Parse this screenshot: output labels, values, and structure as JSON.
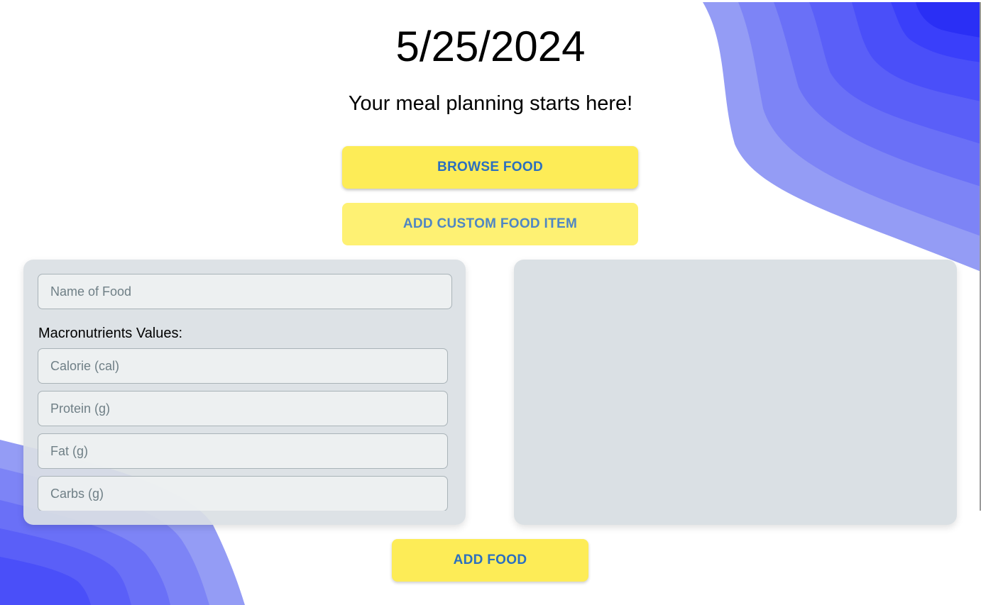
{
  "header": {
    "date": "5/25/2024",
    "subtitle": "Your meal planning starts here!"
  },
  "actions": {
    "browse_label": "BROWSE FOOD",
    "custom_label": "ADD CUSTOM FOOD ITEM",
    "add_label": "ADD FOOD"
  },
  "form": {
    "name_placeholder": "Name of Food",
    "macros_label": "Macronutrients Values:",
    "calorie_placeholder": "Calorie (cal)",
    "protein_placeholder": "Protein (g)",
    "fat_placeholder": "Fat (g)",
    "carbs_placeholder": "Carbs (g)"
  },
  "colors": {
    "button_yellow": "#fdec57",
    "button_text_blue": "#2b6fbf",
    "panel_gray": "#dae0e4",
    "wave_blue_dark": "#2a2ff5",
    "wave_blue_light": "#949cf5"
  }
}
